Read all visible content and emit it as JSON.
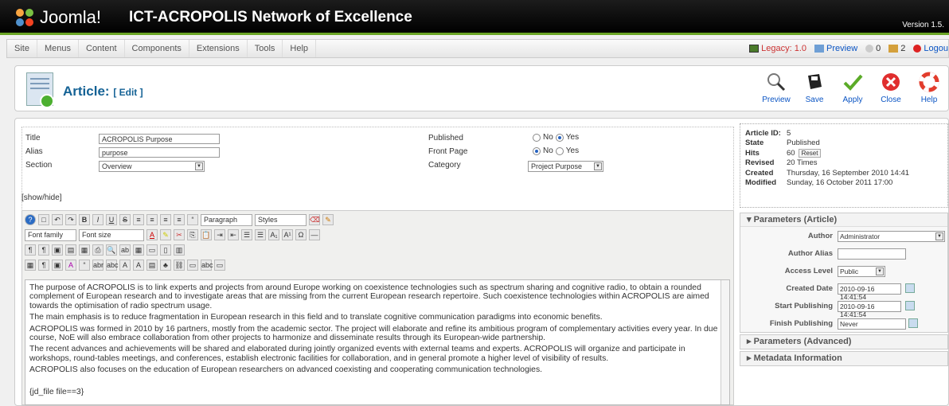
{
  "header": {
    "brand": "Joomla!",
    "site_title": "ICT-ACROPOLIS Network of Excellence",
    "version": "Version 1.5."
  },
  "menu": [
    "Site",
    "Menus",
    "Content",
    "Components",
    "Extensions",
    "Tools",
    "Help"
  ],
  "status": {
    "legacy": "Legacy: 1.0",
    "preview": "Preview",
    "messages": "0",
    "users": "2",
    "logout": "Logou"
  },
  "toolbar": {
    "title": "Article:",
    "mode": "[ Edit ]",
    "buttons": [
      "Preview",
      "Save",
      "Apply",
      "Close",
      "Help"
    ]
  },
  "form": {
    "title_label": "Title",
    "title_value": "ACROPOLIS Purpose",
    "alias_label": "Alias",
    "alias_value": "purpose",
    "section_label": "Section",
    "section_value": "Overview",
    "published_label": "Published",
    "frontpage_label": "Front Page",
    "no": "No",
    "yes": "Yes",
    "category_label": "Category",
    "category_value": "Project Purpose",
    "showhide": "[show/hide]"
  },
  "editor": {
    "paragraph": "Paragraph",
    "styles": "Styles",
    "font_family": "Font family",
    "font_size": "Font size",
    "paragraphs": [
      "The purpose of ACROPOLIS is to link experts and projects from around Europe working on coexistence technologies such as spectrum sharing and cognitive radio, to obtain a rounded complement of European research and to investigate areas that are missing from the current European research repertoire. Such coexistence technologies within ACROPOLIS are aimed towards the optimisation of radio spectrum usage.",
      "The main emphasis is to reduce fragmentation in European research in this field and to translate cognitive communication paradigms into economic benefits.",
      "ACROPOLIS was formed in 2010 by 16 partners, mostly from the academic sector. The project will elaborate and refine its ambitious program of complementary activities every year. In due course, NoE will also embrace collaboration from other projects to harmonize and disseminate results through its European-wide partnership.",
      "The recent advances and achievements will be shared and elaborated during jointly organized events with external teams and experts. ACROPOLIS will organize and participate in workshops, round-tables meetings, and conferences, establish electronic facilities for collaboration, and in general promote a higher level of visibility of results.",
      "ACROPOLIS also focuses on the education of European researchers on advanced coexisting and cooperating communication technologies."
    ],
    "footer_code": "{jd_file file==3}"
  },
  "info": [
    {
      "k": "Article ID:",
      "v": "5"
    },
    {
      "k": "State",
      "v": "Published"
    },
    {
      "k": "Hits",
      "v": "60"
    },
    {
      "k": "Revised",
      "v": "20 Times"
    },
    {
      "k": "Created",
      "v": "Thursday, 16 September 2010 14:41"
    },
    {
      "k": "Modified",
      "v": "Sunday, 16 October 2011 17:00"
    }
  ],
  "reset_label": "Reset",
  "params": {
    "header": "Parameters (Article)",
    "author_label": "Author",
    "author_value": "Administrator",
    "alias_label": "Author Alias",
    "access_label": "Access Level",
    "access_value": "Public",
    "created_label": "Created Date",
    "created_value": "2010-09-16 14:41:54",
    "start_label": "Start Publishing",
    "start_value": "2010-09-16 14:41:54",
    "finish_label": "Finish Publishing",
    "finish_value": "Never"
  },
  "adv_header": "Parameters (Advanced)",
  "meta_header": "Metadata Information"
}
